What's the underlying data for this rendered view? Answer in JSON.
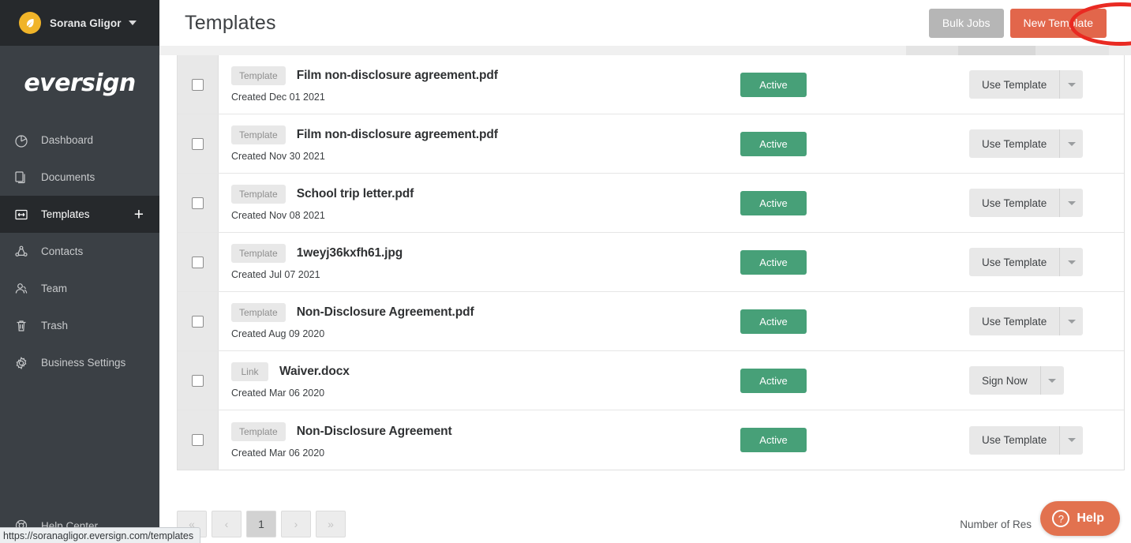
{
  "account": {
    "name": "Sorana Gligor",
    "avatar_icon": "leaf-avatar-icon",
    "caret_icon": "chevron-down-icon"
  },
  "brand": {
    "name": "eversign"
  },
  "sidebar": {
    "items": [
      {
        "label": "Dashboard",
        "icon": "pie-chart-icon",
        "active": false
      },
      {
        "label": "Documents",
        "icon": "documents-icon",
        "active": false
      },
      {
        "label": "Templates",
        "icon": "templates-icon",
        "active": true,
        "plus": "+"
      },
      {
        "label": "Contacts",
        "icon": "contacts-icon",
        "active": false
      },
      {
        "label": "Team",
        "icon": "team-icon",
        "active": false
      },
      {
        "label": "Trash",
        "icon": "trash-icon",
        "active": false
      },
      {
        "label": "Business Settings",
        "icon": "gear-icon",
        "active": false
      }
    ],
    "help_center": {
      "label": "Help Center",
      "icon": "lifebuoy-icon"
    }
  },
  "header": {
    "title": "Templates",
    "bulk_jobs_label": "Bulk Jobs",
    "new_template_label": "New Template"
  },
  "annotation": {
    "shape": "red-ellipse",
    "target": "Bulk Jobs",
    "color": "#e92a22"
  },
  "table": {
    "rows": [
      {
        "badge": "Template",
        "title": "Film non-disclosure agreement.pdf",
        "created": "Created Dec 01 2021",
        "status": "Active",
        "action": "Use Template"
      },
      {
        "badge": "Template",
        "title": "Film non-disclosure agreement.pdf",
        "created": "Created Nov 30 2021",
        "status": "Active",
        "action": "Use Template"
      },
      {
        "badge": "Template",
        "title": "School trip letter.pdf",
        "created": "Created Nov 08 2021",
        "status": "Active",
        "action": "Use Template"
      },
      {
        "badge": "Template",
        "title": "1weyj36kxfh61.jpg",
        "created": "Created Jul 07 2021",
        "status": "Active",
        "action": "Use Template"
      },
      {
        "badge": "Template",
        "title": "Non-Disclosure Agreement.pdf",
        "created": "Created Aug 09 2020",
        "status": "Active",
        "action": "Use Template"
      },
      {
        "badge": "Link",
        "title": "Waiver.docx",
        "created": "Created Mar 06 2020",
        "status": "Active",
        "action": "Sign Now"
      },
      {
        "badge": "Template",
        "title": "Non-Disclosure Agreement",
        "created": "Created Mar 06 2020",
        "status": "Active",
        "action": "Use Template"
      }
    ]
  },
  "footer": {
    "pagination": {
      "first_icon": "double-chevron-left-icon",
      "prev_icon": "chevron-left-icon",
      "current_page": "1",
      "next_icon": "chevron-right-icon",
      "last_icon": "double-chevron-right-icon"
    },
    "results_label": "Number of Res",
    "help_widget": {
      "label": "Help",
      "icon": "question-circle-icon"
    }
  },
  "status_bar": {
    "url": "https://soranagligor.eversign.com/templates"
  },
  "colors": {
    "sidebar_bg": "#3b4045",
    "sidebar_dark": "#26292c",
    "accent_orange": "#e2664b",
    "status_green": "#47a078",
    "bulk_grey": "#b6b6b6",
    "annotation_red": "#e92a22",
    "avatar_yellow": "#f0b429"
  }
}
